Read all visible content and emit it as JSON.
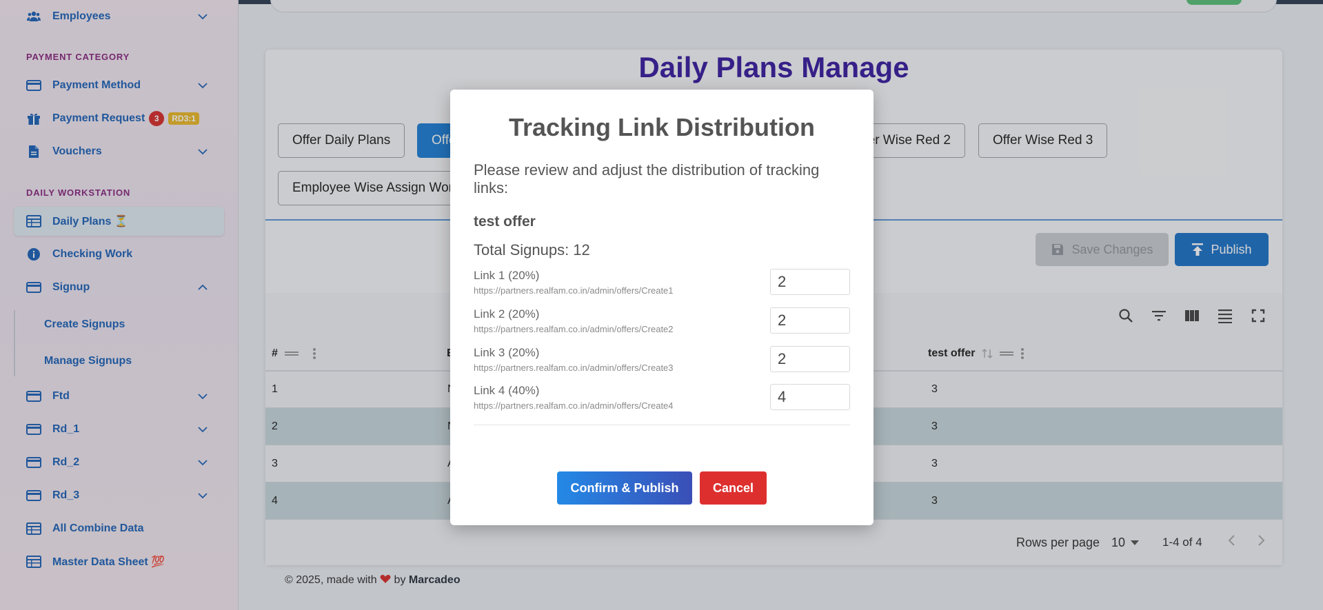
{
  "sidebar": {
    "items": [
      {
        "label": "Employees",
        "icon": "users-icon"
      },
      {
        "label": "Payment Method",
        "icon": "card-icon"
      },
      {
        "label": "Payment Request",
        "icon": "gift-icon",
        "badge_count": "3",
        "badge_tag": "RD3:1"
      },
      {
        "label": "Vouchers",
        "icon": "document-icon"
      },
      {
        "label": "Daily Plans ⏳",
        "icon": "table-icon"
      },
      {
        "label": "Checking Work",
        "icon": "info-icon"
      },
      {
        "label": "Signup",
        "icon": "card-icon"
      },
      {
        "label": "Ftd",
        "icon": "card-icon"
      },
      {
        "label": "Rd_1",
        "icon": "card-icon"
      },
      {
        "label": "Rd_2",
        "icon": "card-icon"
      },
      {
        "label": "Rd_3",
        "icon": "card-icon"
      },
      {
        "label": "All Combine Data",
        "icon": "table-icon"
      },
      {
        "label": "Master Data Sheet 💯",
        "icon": "table-icon"
      }
    ],
    "sections": {
      "payment_category": "PAYMENT CATEGORY",
      "daily_workstation": "DAILY WORKSTATION"
    },
    "signup_sub": [
      "Create Signups",
      "Manage Signups"
    ]
  },
  "page": {
    "title": "Daily Plans Manage",
    "tabs": [
      "Offer Daily Plans",
      "Offe",
      "er Wise Red 2",
      "Offer Wise Red 3",
      "Employee Wise Assign Wor"
    ],
    "save_label": "Save Changes",
    "publish_label": "Publish"
  },
  "table": {
    "headers": [
      "#",
      "E",
      "test offer"
    ],
    "rows": [
      {
        "num": "1",
        "col1": "N",
        "val": "3"
      },
      {
        "num": "2",
        "col1": "N",
        "val": "3"
      },
      {
        "num": "3",
        "col1": "A",
        "val": "3"
      },
      {
        "num": "4",
        "col1": "A",
        "val": "3"
      }
    ],
    "rows_per_page_label": "Rows per page",
    "rows_per_page_value": "10",
    "range": "1-4 of 4"
  },
  "footer": {
    "text": "© 2025, made with",
    "by": "by",
    "brand": "Marcadeo"
  },
  "modal": {
    "title": "Tracking Link Distribution",
    "description": "Please review and adjust the distribution of tracking links:",
    "offer_name": "test offer",
    "total_signups": "Total Signups: 12",
    "links": [
      {
        "label": "Link 1 (20%)",
        "url": "https://partners.realfam.co.in/admin/offers/Create1",
        "value": "2"
      },
      {
        "label": "Link 2 (20%)",
        "url": "https://partners.realfam.co.in/admin/offers/Create2",
        "value": "2"
      },
      {
        "label": "Link 3 (20%)",
        "url": "https://partners.realfam.co.in/admin/offers/Create3",
        "value": "2"
      },
      {
        "label": "Link 4 (40%)",
        "url": "https://partners.realfam.co.in/admin/offers/Create4",
        "value": "4"
      }
    ],
    "confirm_label": "Confirm & Publish",
    "cancel_label": "Cancel"
  },
  "colors": {
    "accent": "#1f73c9",
    "title": "#3a1fa0",
    "danger": "#de2f2f",
    "section_head": "#8a2a82"
  }
}
